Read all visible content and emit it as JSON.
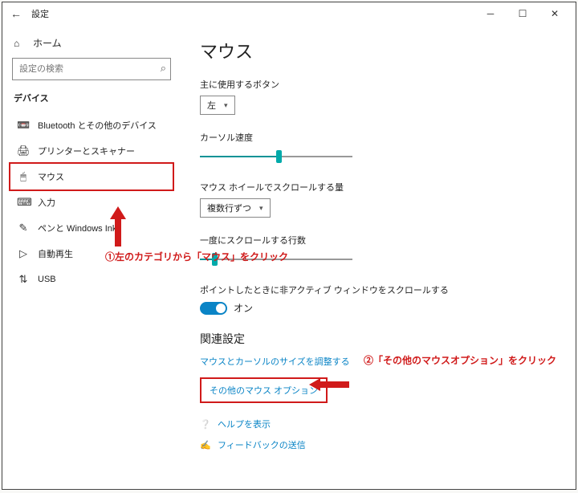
{
  "titlebar": {
    "title": "設定"
  },
  "sidebar": {
    "home": "ホーム",
    "search_placeholder": "設定の検索",
    "section": "デバイス",
    "items": [
      {
        "icon": "📼",
        "label": "Bluetooth とその他のデバイス"
      },
      {
        "icon": "🖨",
        "label": "プリンターとスキャナー"
      },
      {
        "icon": "🖱",
        "label": "マウス"
      },
      {
        "icon": "⌨",
        "label": "入力"
      },
      {
        "icon": "✎",
        "label": "ペンと Windows Ink"
      },
      {
        "icon": "▷",
        "label": "自動再生"
      },
      {
        "icon": "⇅",
        "label": "USB"
      }
    ]
  },
  "content": {
    "heading": "マウス",
    "primary_button": {
      "label": "主に使用するボタン",
      "value": "左"
    },
    "cursor_speed": {
      "label": "カーソル速度",
      "percent": 50
    },
    "wheel_amount": {
      "label": "マウス ホイールでスクロールする量",
      "value": "複数行ずつ"
    },
    "lines_at_once": {
      "label": "一度にスクロールする行数",
      "percent": 8
    },
    "inactive_scroll": {
      "label": "ポイントしたときに非アクティブ ウィンドウをスクロールする",
      "state": "オン"
    },
    "related": {
      "heading": "関連設定",
      "link1": "マウスとカーソルのサイズを調整する",
      "link2": "その他のマウス オプション"
    },
    "help": {
      "show_help": "ヘルプを表示",
      "feedback": "フィードバックの送信"
    }
  },
  "annotations": {
    "anno1": "①左のカテゴリから「マウス」をクリック",
    "anno2": "②「その他のマウスオプション」をクリック"
  }
}
